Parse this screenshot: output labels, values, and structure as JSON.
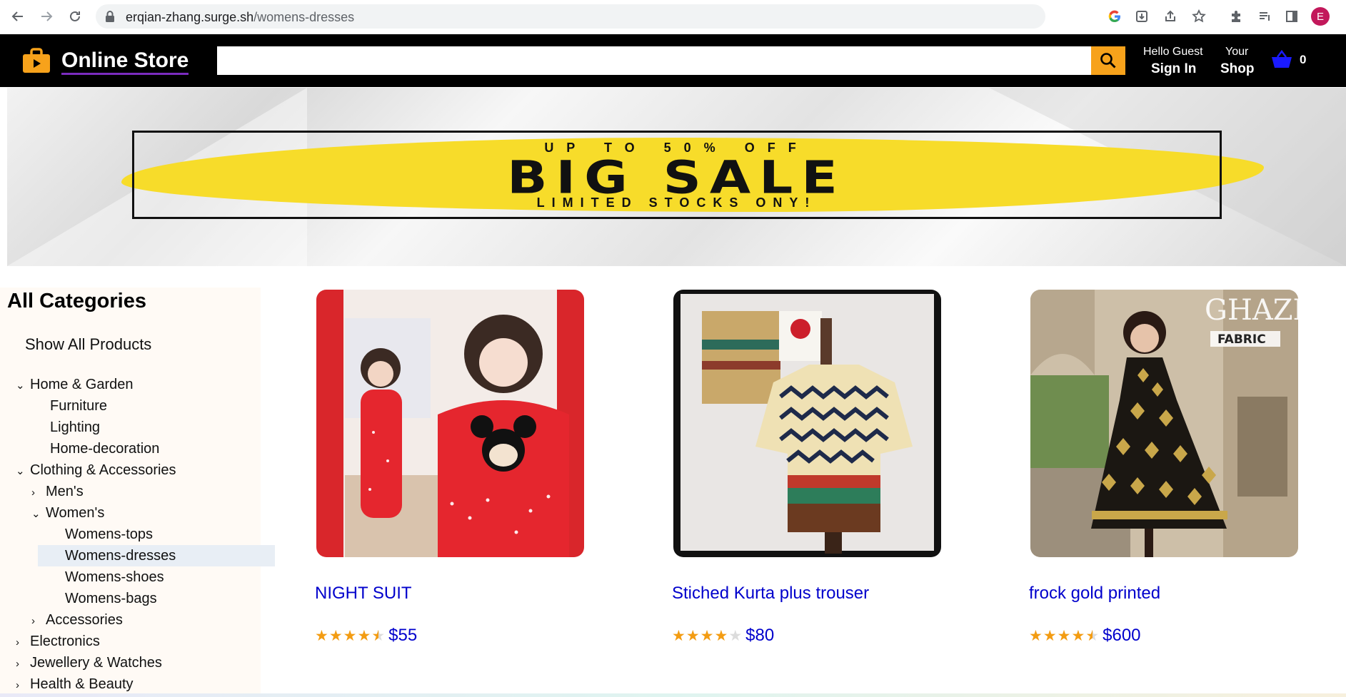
{
  "browser": {
    "url_host": "erqian-zhang.surge.sh",
    "url_path": "/womens-dresses",
    "profile_initial": "E"
  },
  "header": {
    "logo_text": "Online Store",
    "search_placeholder": "",
    "greeting": "Hello Guest",
    "sign_in": "Sign In",
    "your": "Your",
    "shop": "Shop",
    "cart_count": "0",
    "accent_color": "#f7a21b"
  },
  "banner": {
    "top_text": "UP TO 50% OFF",
    "main_text": "BIG SALE",
    "bottom_text": "LIMITED STOCKS ONY!"
  },
  "sidebar": {
    "title": "All Categories",
    "show_all": "Show All Products",
    "items": [
      {
        "label": "Home & Garden",
        "chevron": "down"
      },
      {
        "label": "Furniture",
        "chevron": ""
      },
      {
        "label": "Lighting",
        "chevron": ""
      },
      {
        "label": "Home-decoration",
        "chevron": ""
      },
      {
        "label": "Clothing & Accessories",
        "chevron": "down"
      },
      {
        "label": "Men's",
        "chevron": "right"
      },
      {
        "label": "Women's",
        "chevron": "down"
      },
      {
        "label": "Womens-tops",
        "chevron": ""
      },
      {
        "label": "Womens-dresses",
        "chevron": "",
        "active": true
      },
      {
        "label": "Womens-shoes",
        "chevron": ""
      },
      {
        "label": "Womens-bags",
        "chevron": ""
      },
      {
        "label": "Accessories",
        "chevron": "right"
      },
      {
        "label": "Electronics",
        "chevron": "right"
      },
      {
        "label": "Jewellery & Watches",
        "chevron": "right"
      },
      {
        "label": "Health & Beauty",
        "chevron": "right"
      }
    ]
  },
  "products": [
    {
      "title": "NIGHT SUIT",
      "rating": 4.5,
      "price": "$55"
    },
    {
      "title": "Stiched Kurta plus trouser",
      "rating": 4,
      "price": "$80"
    },
    {
      "title": "frock gold printed",
      "rating": 4.5,
      "price": "$600"
    }
  ]
}
